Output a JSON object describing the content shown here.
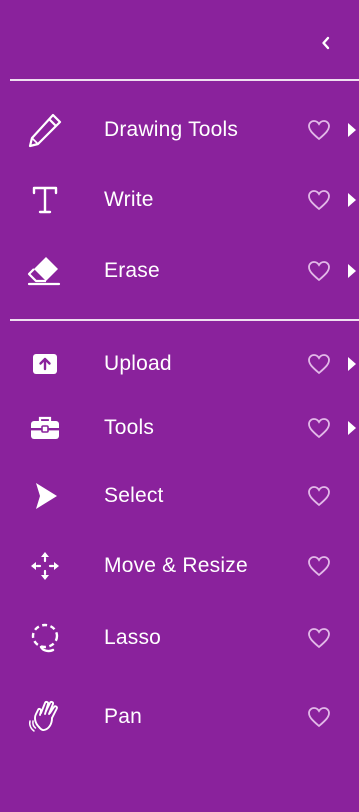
{
  "colors": {
    "background": "#8a229c",
    "text": "#ffffff",
    "heart": "#e2b9e8"
  },
  "header": {
    "collapse_icon": "chevron-left-icon"
  },
  "menu": {
    "drawing_tools": {
      "label": "Drawing Tools",
      "icon": "pencil-icon",
      "has_submenu": true
    },
    "write": {
      "label": "Write",
      "icon": "text-icon",
      "has_submenu": true
    },
    "erase": {
      "label": "Erase",
      "icon": "eraser-icon",
      "has_submenu": true
    },
    "upload": {
      "label": "Upload",
      "icon": "upload-icon",
      "has_submenu": true
    },
    "tools": {
      "label": "Tools",
      "icon": "toolbox-icon",
      "has_submenu": true
    },
    "select": {
      "label": "Select",
      "icon": "pointer-icon",
      "has_submenu": false
    },
    "move_resize": {
      "label": "Move & Resize",
      "icon": "move-arrows-icon",
      "has_submenu": false
    },
    "lasso": {
      "label": "Lasso",
      "icon": "lasso-icon",
      "has_submenu": false
    },
    "pan": {
      "label": "Pan",
      "icon": "hand-icon",
      "has_submenu": false
    }
  }
}
